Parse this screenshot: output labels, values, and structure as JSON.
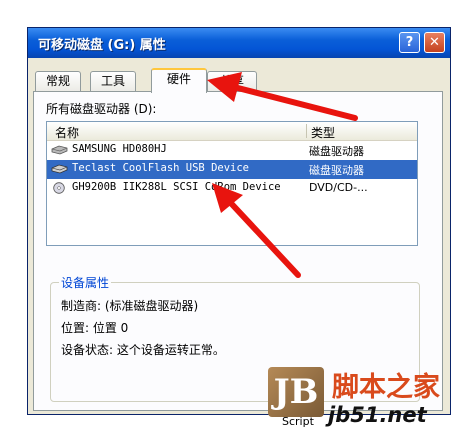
{
  "window": {
    "title": "可移动磁盘 (G:) 属性",
    "help_label": "?",
    "close_label": "✕"
  },
  "tabs": [
    {
      "label": "常规",
      "active": false
    },
    {
      "label": "工具",
      "active": false
    },
    {
      "label": "硬件",
      "active": true
    },
    {
      "label": "共享",
      "active": false
    }
  ],
  "hardware": {
    "devices_label": "所有磁盘驱动器 (D):",
    "columns": {
      "name": "名称",
      "type": "类型"
    },
    "devices": [
      {
        "name": "SAMSUNG HD080HJ",
        "type": "磁盘驱动器",
        "selected": false,
        "icon": "disk-drive-icon"
      },
      {
        "name": "Teclast CoolFlash USB Device",
        "type": "磁盘驱动器",
        "selected": true,
        "icon": "disk-drive-icon"
      },
      {
        "name": "GH9200B IIK288L SCSI CdRom Device",
        "type": "DVD/CD-...",
        "selected": false,
        "icon": "cdrom-icon"
      }
    ],
    "properties": {
      "title": "设备属性",
      "manufacturer": "制造商: (标准磁盘驱动器)",
      "location": "位置: 位置 0",
      "status": "设备状态: 这个设备运转正常。"
    }
  },
  "watermark": {
    "logo_text": "JB",
    "script_label": "Script",
    "site_name": "脚本之家",
    "site_url": "jb51.net"
  },
  "colors": {
    "titlebar": "#0455d6",
    "selection": "#316ac5",
    "arrow": "#e8140e",
    "accent_orange": "#d94a1c"
  }
}
